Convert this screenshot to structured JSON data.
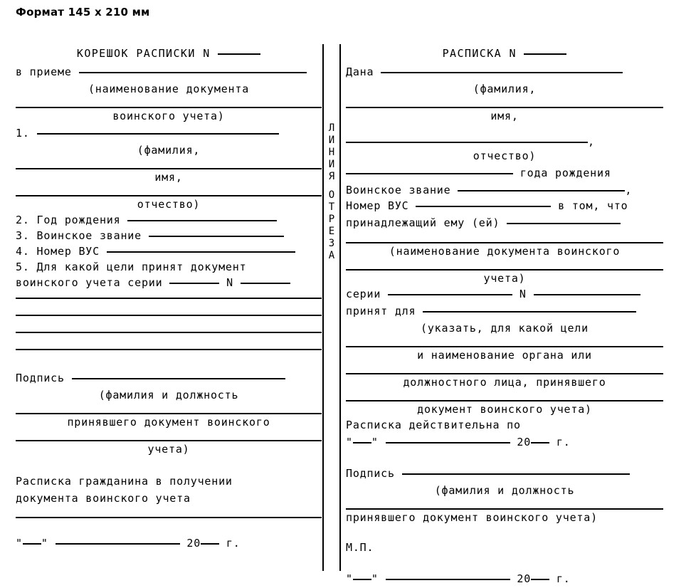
{
  "header": {
    "format_label": "Формат 145 x 210 мм"
  },
  "cut_line": {
    "word_1": "Л",
    "word_2": "И",
    "word_3": "Н",
    "word_4": "И",
    "word_5": "Я",
    "word_6": "О",
    "word_7": "Т",
    "word_8": "Р",
    "word_9": "Е",
    "word_10": "З",
    "word_11": "А",
    "full_text": "ЛИНИЯ ОТРЕЗА"
  },
  "stub": {
    "title": "КОРЕШОК РАСПИСКИ N",
    "in_receipt_label": "в приемe",
    "in_receipt_label_real": "в приеме",
    "hint_doc_name": "(наименование документа",
    "hint_military_record": "воинского учета)",
    "item_1_number": "1.",
    "hint_surname": "(фамилия,",
    "hint_firstname": "имя,",
    "hint_patronymic": "отчество)",
    "item_2": "2. Год рождения",
    "item_3": "3. Воинское звание",
    "item_4": "4. Номер ВУС",
    "item_5_line_1": "5. Для  какой цели принят  документ",
    "item_5_line_2_a": "воинского учета серии",
    "item_5_line_2_n": "N",
    "signature_label": "Подпись",
    "hint_signature_1": "(фамилия и должность",
    "hint_signature_2": "принявшего документ воинского",
    "hint_signature_3": "учета)",
    "citizen_receipt_line_1": "Расписка  гражданина  в  получении",
    "citizen_receipt_line_2": "документа воинского учета",
    "date_quote_open": "\"",
    "date_quote_close": "\"",
    "date_year_prefix": "20",
    "date_year_suffix": "г."
  },
  "receipt": {
    "title": "РАСПИСКА N",
    "given_label": "Дана",
    "hint_surname": "(фамилия,",
    "hint_firstname": "имя,",
    "hint_patronymic": "отчество)",
    "comma_after_patronymic": ",",
    "year_of_birth_label": "года рождения",
    "rank_label": "Воинское звание",
    "rank_comma": ",",
    "vus_label": "Номер ВУС",
    "vus_tail": "в том, что",
    "belonging_label": "принадлежащий ему (ей)",
    "hint_doc_name_1": "(наименование документа воинского",
    "hint_doc_name_2": "учета)",
    "series_label": "серии",
    "series_n": "N",
    "accepted_for_label": "принят для",
    "hint_purpose_1": "(указать, для какой цели",
    "hint_purpose_2": "и наименование органа или",
    "hint_purpose_3": "должностного лица, принявшего",
    "hint_purpose_4": "документ воинского учета)",
    "valid_until_label": "Расписка действительна по",
    "date_quote_open": "\"",
    "date_quote_close": "\"",
    "date_year_prefix": "20",
    "date_year_suffix": "г.",
    "signature_label": "Подпись",
    "hint_signature_1": "(фамилия и должность",
    "hint_signature_2": "принявшего документ воинского учета)",
    "stamp_label": "М.П.",
    "final_date_quote_open": "\"",
    "final_date_quote_close": "\"",
    "final_date_year_prefix": "20",
    "final_date_year_suffix": "г."
  },
  "colors": {
    "ink": "#000000",
    "paper": "#ffffff"
  }
}
